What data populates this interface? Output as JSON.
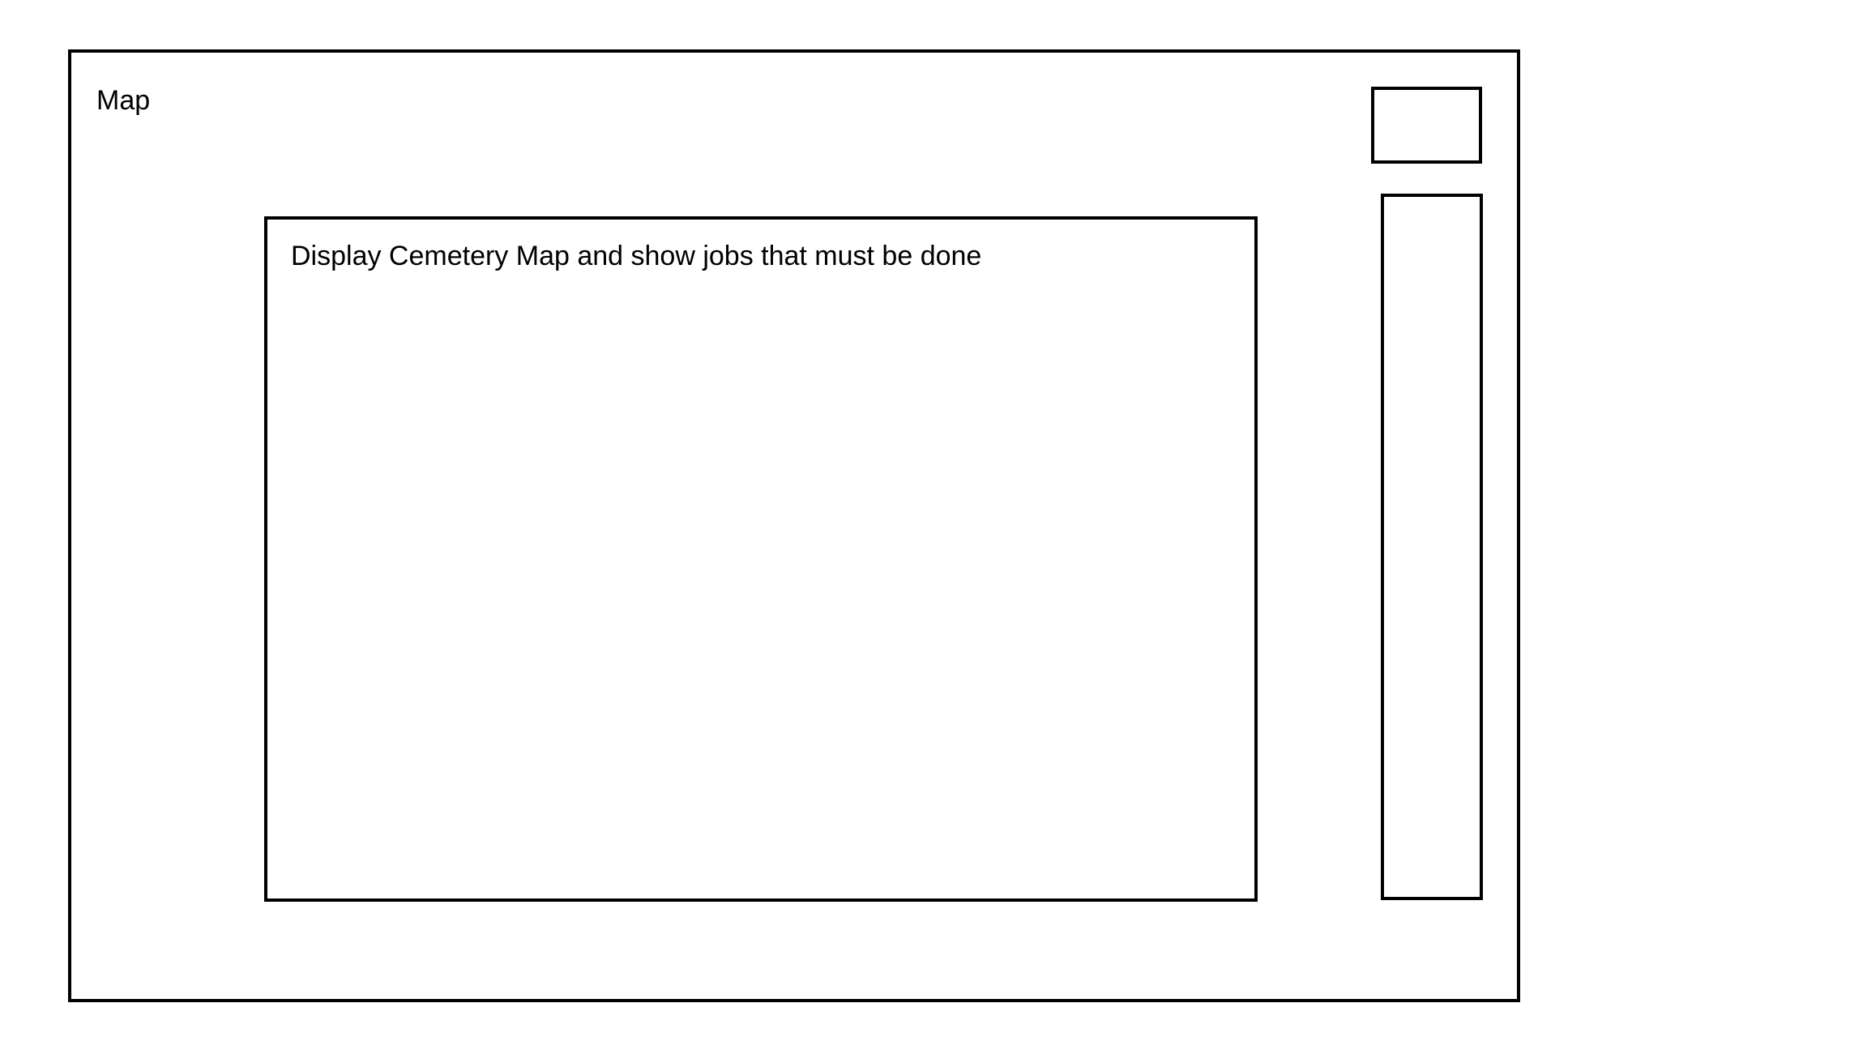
{
  "window": {
    "title": "Map"
  },
  "map": {
    "caption": "Display Cemetery Map and show jobs that must be done"
  }
}
